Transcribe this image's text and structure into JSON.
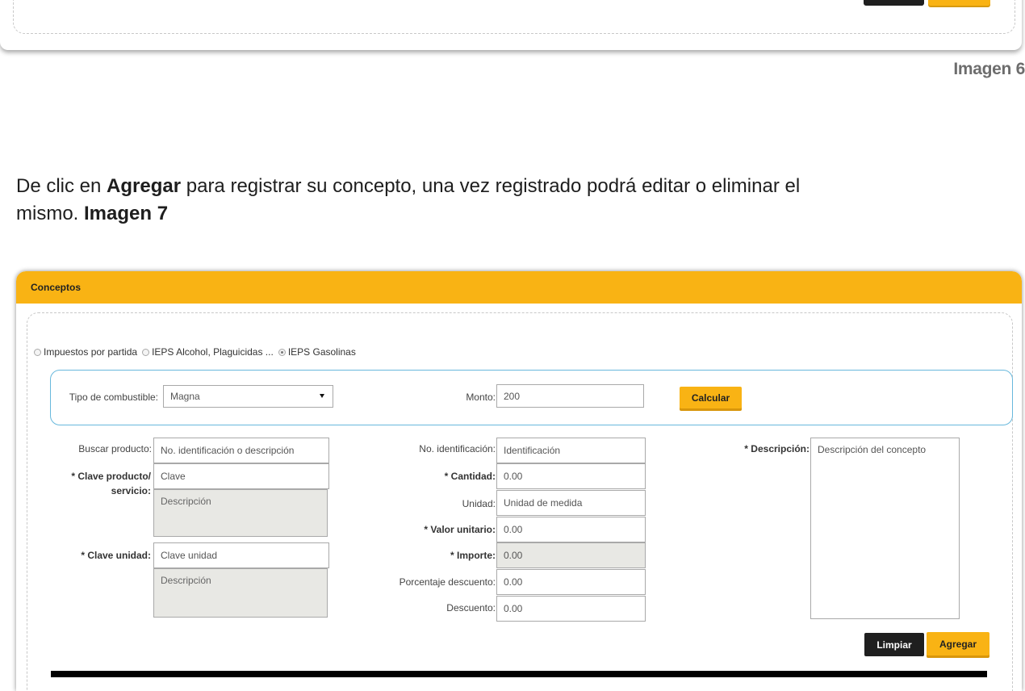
{
  "caption_prev": "Imagen 6",
  "instruction": {
    "prefix": "De clic en ",
    "bold1": "Agregar",
    "middle": " para registrar su concepto, una vez registrado podrá editar o eliminar el",
    "line2": "mismo. ",
    "bold2": "Imagen 7"
  },
  "panel": {
    "title": "Conceptos",
    "radios": [
      {
        "label": "Impuestos por partida",
        "selected": false
      },
      {
        "label": "IEPS Alcohol, Plaguicidas ...",
        "selected": false
      },
      {
        "label": "IEPS Gasolinas",
        "selected": true
      }
    ],
    "fuel": {
      "tipo_label": "Tipo de combustible:",
      "tipo_value": "Magna",
      "monto_label": "Monto:",
      "monto_value": "200",
      "calcular": "Calcular"
    },
    "col1": {
      "buscar_label": "Buscar producto:",
      "buscar_placeholder": "No. identificación o descripción",
      "clave_prod_label_1": "* Clave producto/",
      "clave_prod_label_2": "servicio:",
      "clave_prod_placeholder": "Clave",
      "clave_prod_desc": "Descripción",
      "clave_unidad_label": "* Clave unidad:",
      "clave_unidad_placeholder": "Clave unidad",
      "clave_unidad_desc": "Descripción"
    },
    "col2": {
      "noid_label": "No. identificación:",
      "noid_placeholder": "Identificación",
      "cantidad_label": "* Cantidad:",
      "cantidad_value": "0.00",
      "unidad_label": "Unidad:",
      "unidad_placeholder": "Unidad de medida",
      "valor_label": "* Valor unitario:",
      "valor_value": "0.00",
      "importe_label": "* Importe:",
      "importe_value": "0.00",
      "porcentaje_label": "Porcentaje descuento:",
      "porcentaje_value": "0.00",
      "descuento_label": "Descuento:",
      "descuento_value": "0.00"
    },
    "col3": {
      "descripcion_label": "* Descripción:",
      "descripcion_placeholder": "Descripción del concepto"
    },
    "buttons": {
      "limpiar": "Limpiar",
      "agregar": "Agregar"
    }
  },
  "colors": {
    "accent_yellow": "#f9b314",
    "dark_button": "#1f1f1f",
    "fuel_border": "#68b8dc"
  }
}
